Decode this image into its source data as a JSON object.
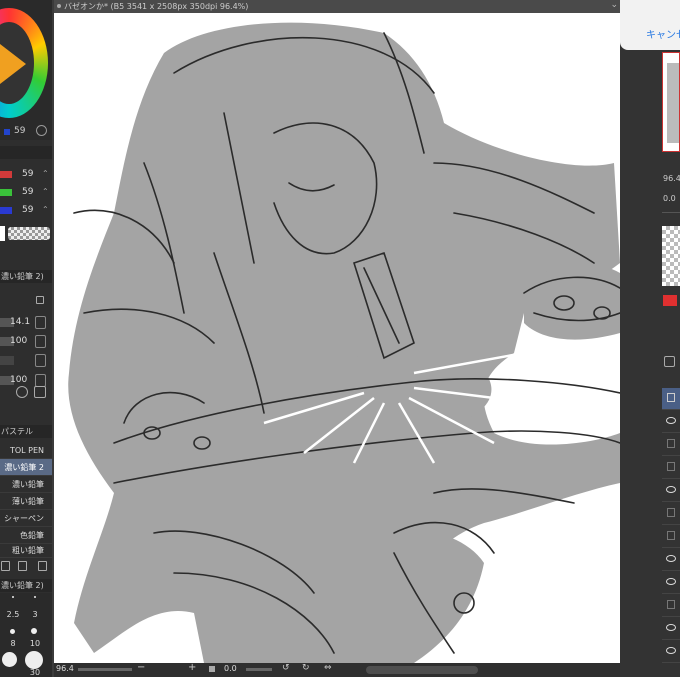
{
  "doc": {
    "title": "バゼオンか* (B5 3541 x 2508px 350dpi 96.4%)"
  },
  "color": {
    "wheel_value": "59",
    "r": "59",
    "g": "59",
    "b": "59",
    "accent": "#f0a020"
  },
  "subtool_header": "濃い鉛筆 2)",
  "tool_property": {
    "brush_size": "14.1",
    "opacity": "100",
    "density": "100"
  },
  "brush_group": "パステル",
  "brushes": [
    {
      "label": "TOL PEN",
      "active": false
    },
    {
      "label": "濃い鉛筆 2",
      "active": true
    },
    {
      "label": "濃い鉛筆",
      "active": false
    },
    {
      "label": "薄い鉛筆",
      "active": false
    },
    {
      "label": "シャーペン",
      "active": false
    },
    {
      "label": "色鉛筆",
      "active": false
    },
    {
      "label": "粗い鉛筆",
      "active": false
    }
  ],
  "size_header": "濃い鉛筆 2)",
  "brush_sizes": [
    "2.5",
    "3",
    "8",
    "10",
    "30"
  ],
  "bottom_bar": {
    "zoom": "96.4",
    "angle": "0.0"
  },
  "right_panel": {
    "cancel_label": "キャンセル",
    "nav_zoom": "96.4",
    "nav_angle": "0.0"
  }
}
